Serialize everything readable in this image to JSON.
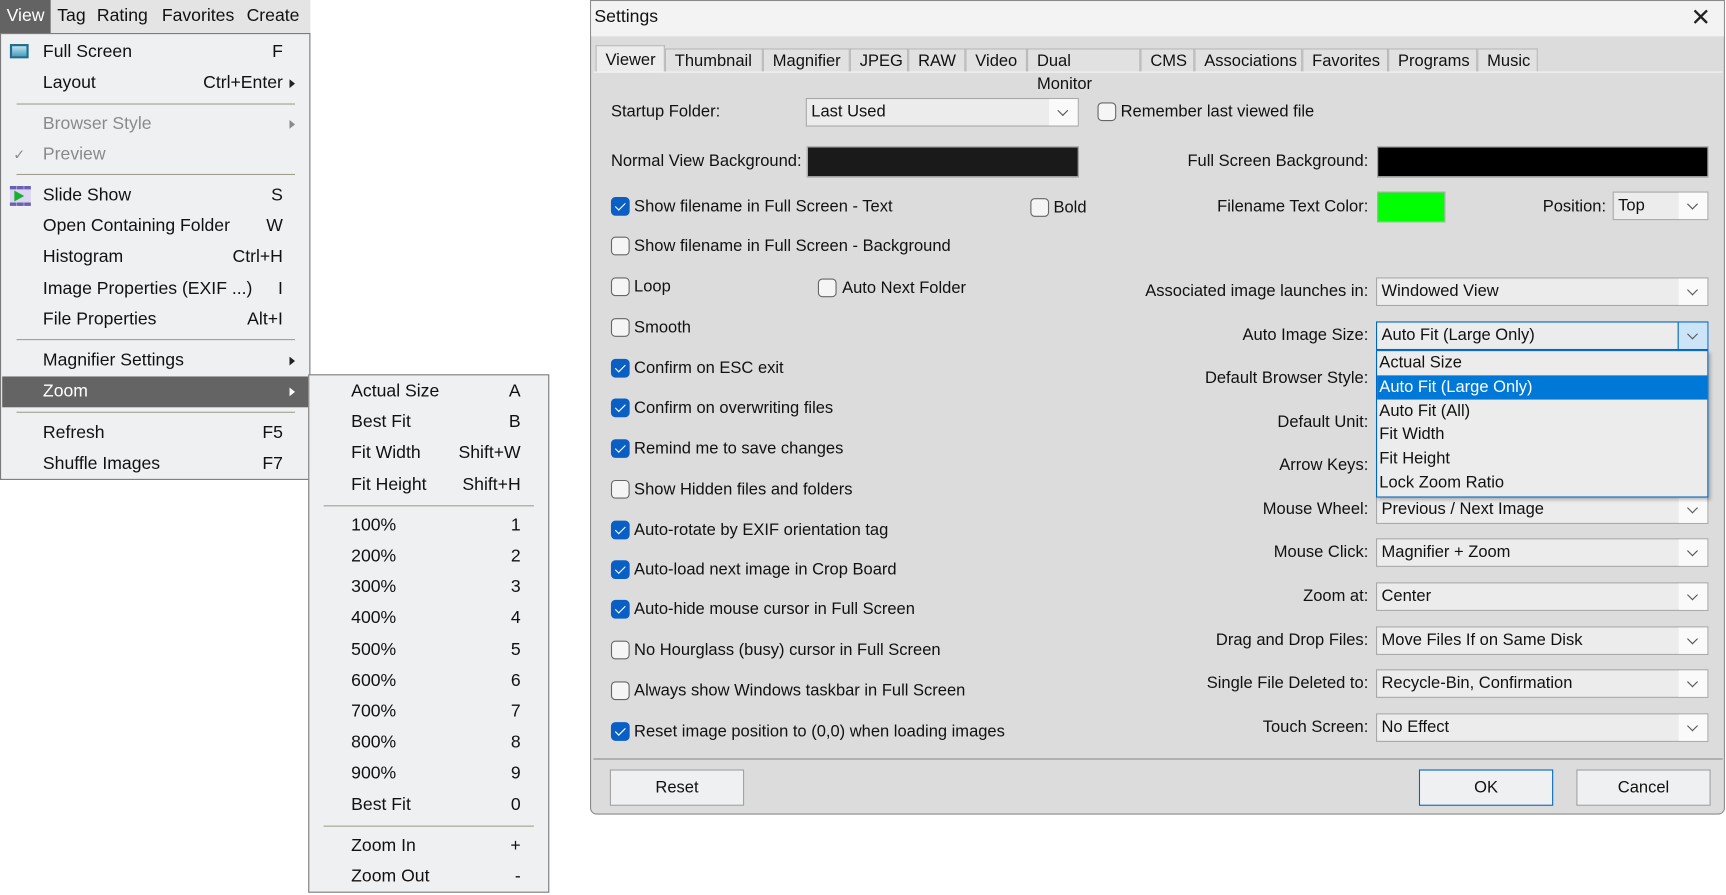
{
  "menubar": [
    "View",
    "Tag",
    "Rating",
    "Favorites",
    "Create"
  ],
  "view_menu": [
    {
      "label": "Full Screen",
      "shortcut": "F",
      "icon": "fullscreen-icon"
    },
    {
      "label": "Layout",
      "shortcut": "Ctrl+Enter",
      "submenu": true
    },
    {
      "sep": true
    },
    {
      "label": "Browser Style",
      "disabled": true,
      "submenu": true
    },
    {
      "label": "Preview",
      "disabled": true,
      "checked": true
    },
    {
      "sep": true
    },
    {
      "label": "Slide Show",
      "shortcut": "S",
      "icon": "slideshow-icon"
    },
    {
      "label": "Open Containing Folder",
      "shortcut": "W"
    },
    {
      "label": "Histogram",
      "shortcut": "Ctrl+H"
    },
    {
      "label": "Image Properties (EXIF ...)",
      "shortcut": "I"
    },
    {
      "label": "File Properties",
      "shortcut": "Alt+I"
    },
    {
      "sep": true
    },
    {
      "label": "Magnifier Settings",
      "submenu": true
    },
    {
      "label": "Zoom",
      "submenu": true,
      "highlighted": true
    },
    {
      "sep": true
    },
    {
      "label": "Refresh",
      "shortcut": "F5"
    },
    {
      "label": "Shuffle Images",
      "shortcut": "F7"
    }
  ],
  "zoom_menu": [
    {
      "label": "Actual Size",
      "shortcut": "A"
    },
    {
      "label": "Best Fit",
      "shortcut": "B"
    },
    {
      "label": "Fit Width",
      "shortcut": "Shift+W"
    },
    {
      "label": "Fit Height",
      "shortcut": "Shift+H"
    },
    {
      "sep": true
    },
    {
      "label": "100%",
      "shortcut": "1"
    },
    {
      "label": "200%",
      "shortcut": "2"
    },
    {
      "label": "300%",
      "shortcut": "3"
    },
    {
      "label": "400%",
      "shortcut": "4"
    },
    {
      "label": "500%",
      "shortcut": "5"
    },
    {
      "label": "600%",
      "shortcut": "6"
    },
    {
      "label": "700%",
      "shortcut": "7"
    },
    {
      "label": "800%",
      "shortcut": "8"
    },
    {
      "label": "900%",
      "shortcut": "9"
    },
    {
      "label": "Best Fit",
      "shortcut": "0"
    },
    {
      "sep": true
    },
    {
      "label": "Zoom In",
      "shortcut": "+"
    },
    {
      "label": "Zoom Out",
      "shortcut": "-"
    }
  ],
  "dialog": {
    "title": "Settings",
    "close_icon": "close-icon",
    "tabs": [
      "Viewer",
      "Thumbnail",
      "Magnifier",
      "JPEG",
      "RAW",
      "Video",
      "Dual Monitor",
      "CMS",
      "Associations",
      "Favorites",
      "Programs",
      "Music"
    ],
    "active_tab": "Viewer",
    "startup_folder": {
      "label": "Startup Folder:",
      "value": "Last Used"
    },
    "remember_last": {
      "label": "Remember last viewed file",
      "checked": false
    },
    "normal_bg": {
      "label": "Normal View Background:",
      "color": "#1a1a1a"
    },
    "fullscreen_bg": {
      "label": "Full Screen Background:",
      "color": "#000000"
    },
    "filename_color": {
      "label": "Filename Text Color:",
      "color": "#00ff00"
    },
    "position": {
      "label": "Position:",
      "value": "Top"
    },
    "bold": {
      "label": "Bold",
      "checked": false
    },
    "auto_next_folder": {
      "label": "Auto Next Folder",
      "checked": false
    },
    "checkboxes": [
      {
        "label": "Show filename in Full Screen - Text",
        "checked": true
      },
      {
        "label": "Show filename in Full Screen - Background",
        "checked": false
      },
      {
        "label": "Loop",
        "checked": false
      },
      {
        "label": "Smooth",
        "checked": false
      },
      {
        "label": "Confirm on ESC exit",
        "checked": true
      },
      {
        "label": "Confirm on overwriting files",
        "checked": true
      },
      {
        "label": "Remind me to save changes",
        "checked": true
      },
      {
        "label": "Show Hidden files and folders",
        "checked": false
      },
      {
        "label": "Auto-rotate by EXIF orientation tag",
        "checked": true
      },
      {
        "label": "Auto-load next image in Crop Board",
        "checked": true
      },
      {
        "label": "Auto-hide mouse cursor in Full Screen",
        "checked": true
      },
      {
        "label": "No Hourglass (busy) cursor in Full Screen",
        "checked": false
      },
      {
        "label": "Always show Windows taskbar in Full Screen",
        "checked": false
      },
      {
        "label": "Reset image position to (0,0) when loading images",
        "checked": true
      }
    ],
    "right_fields": [
      {
        "label": "Associated image launches in:",
        "value": "Windowed View"
      },
      {
        "label": "Auto Image Size:",
        "value": "Auto Fit (Large Only)",
        "focused": true
      },
      {
        "label": "Default Browser Style:",
        "hidden": true
      },
      {
        "label": "Default Unit:",
        "hidden": true
      },
      {
        "label": "Arrow Keys:",
        "hidden": true
      },
      {
        "label": "Mouse Wheel:",
        "value": "Previous / Next Image"
      },
      {
        "label": "Mouse Click:",
        "value": "Magnifier + Zoom"
      },
      {
        "label": "Zoom at:",
        "value": "Center"
      },
      {
        "label": "Drag and Drop Files:",
        "value": "Move Files If on Same Disk"
      },
      {
        "label": "Single File Deleted to:",
        "value": "Recycle-Bin, Confirmation"
      },
      {
        "label": "Touch Screen:",
        "value": "No Effect"
      }
    ],
    "auto_size_options": [
      "Actual Size",
      "Auto Fit (Large Only)",
      "Auto Fit (All)",
      "Fit Width",
      "Fit Height",
      "Lock Zoom Ratio"
    ],
    "auto_size_selected": 1,
    "buttons": {
      "reset": "Reset",
      "ok": "OK",
      "cancel": "Cancel"
    },
    "accent": "#0078d7"
  }
}
